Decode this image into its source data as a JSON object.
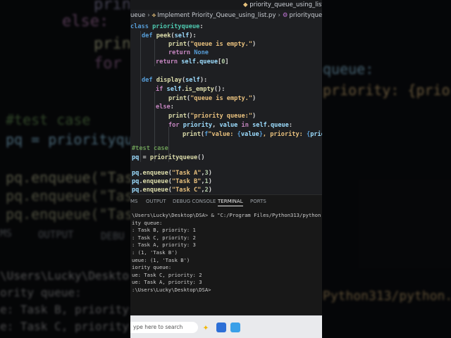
{
  "editor": {
    "tab_label": "priority_queue_using_list.py",
    "breadcrumb": {
      "folder": "ueue",
      "file": "Implement Priority_Queue_using_list.py",
      "symbol": "priorityqueue"
    },
    "code_lines": [
      "class priorityqueue:",
      "    def peek(self):",
      "            print(\"queue is empty.\")",
      "            return None",
      "        return self.queue[0]",
      "",
      "    def display(self):",
      "        if self.is_empty():",
      "            print(\"queue is empty.\")",
      "        else:",
      "            print(\"priority queue:\")",
      "            for priority, value in self.queue:",
      "                print(f\"value: {value}, priority: {prio",
      "",
      "#test case",
      "pq = priorityqueue()",
      "",
      "pq.enqueue(\"Task A\",3)",
      "pq.enqueue(\"Task B\",1)",
      "pq.enqueue(\"Task C\",2)"
    ]
  },
  "panel": {
    "tabs": [
      "MS",
      "OUTPUT",
      "DEBUG CONSOLE",
      "TERMINAL",
      "PORTS"
    ],
    "active_tab": "TERMINAL",
    "terminal_lines": [
      "\\Users\\Lucky\\Desktop\\DSA> & \"C:/Program Files/Python313/python.",
      "ity queue:",
      ": Task B, priority: 1",
      ": Task C, priority: 2",
      ": Task A, priority: 3",
      ": (1, 'Task B')",
      "ueue: (1, 'Task B')",
      "iority queue:",
      "ue: Task C, priority: 2",
      "ue: Task A, priority: 3",
      ":\\Users\\Lucky\\Desktop\\DSA>"
    ]
  },
  "taskbar": {
    "search_placeholder": "ype here to search"
  },
  "background_text": [
    "print",
    "else:",
    "print",
    "for",
    "#test case",
    "pq = priorityque",
    "pq.enqueue(\"Task",
    "pq.enqueue(\"Task",
    "pq.enqueue(\"Task",
    "MS",
    "OUTPUT",
    "DEBU",
    "\\Users\\Lucky\\Deskto",
    "ority queue:",
    "e: Task B, priority:",
    "e: Task C, priority:",
    "queue:",
    "priority: {prio",
    "Python313/python."
  ],
  "colors": {
    "keyword": "#569cd6",
    "control": "#c586c0",
    "function": "#dcdcaa",
    "string": "#e8c07d",
    "number": "#b5cea8",
    "comment": "#6a9955",
    "editor_bg": "#1e1f22"
  }
}
